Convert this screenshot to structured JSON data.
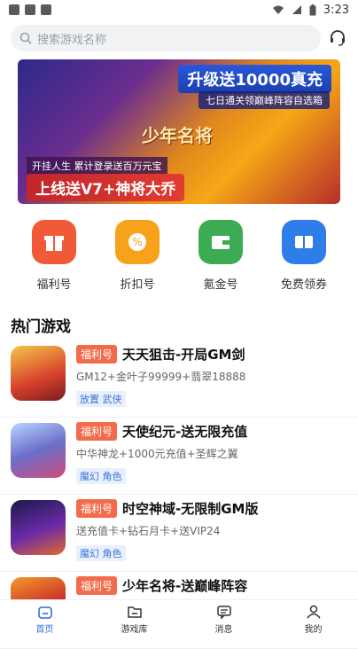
{
  "status_bar": {
    "time": "3:23"
  },
  "search": {
    "placeholder": "搜索游戏名称"
  },
  "banner": {
    "headline": "升级送10000真充",
    "subline": "七日通关领巅峰阵容自选箱",
    "line3": "开挂人生 累计登录送百万元宝",
    "line4": "上线送V7+神将大乔",
    "logo": "少年名将"
  },
  "categories": [
    {
      "label": "福利号",
      "icon": "gift-icon",
      "color": "#f15a36"
    },
    {
      "label": "折扣号",
      "icon": "discount-icon",
      "color": "#f7a21b"
    },
    {
      "label": "氪金号",
      "icon": "wallet-icon",
      "color": "#3cab54"
    },
    {
      "label": "免费领券",
      "icon": "coupon-icon",
      "color": "#2f7de8"
    }
  ],
  "hot": {
    "title": "热门游戏",
    "games": [
      {
        "tag": "福利号",
        "title": "天天狙击-开局GM剑",
        "desc": "GM12+金叶子99999+翡翠18888",
        "genres": "放置 武侠"
      },
      {
        "tag": "福利号",
        "title": "天使纪元-送无限充值",
        "desc": "中华神龙+1000元充值+圣辉之翼",
        "genres": "魔幻 角色"
      },
      {
        "tag": "福利号",
        "title": "时空神域-无限制GM版",
        "desc": "送充值卡+钻石月卡+送VIP24",
        "genres": "魔幻 角色"
      },
      {
        "tag": "福利号",
        "title": "少年名将-送巅峰阵容",
        "desc": "",
        "genres": ""
      }
    ]
  },
  "tabs": [
    {
      "label": "首页",
      "icon": "home-icon"
    },
    {
      "label": "游戏库",
      "icon": "folder-icon"
    },
    {
      "label": "消息",
      "icon": "message-icon"
    },
    {
      "label": "我的",
      "icon": "profile-icon"
    }
  ],
  "colors": {
    "accent": "#2f6de1",
    "tag_red": "#f26b4a",
    "genre_blue": "#3b73d9"
  }
}
